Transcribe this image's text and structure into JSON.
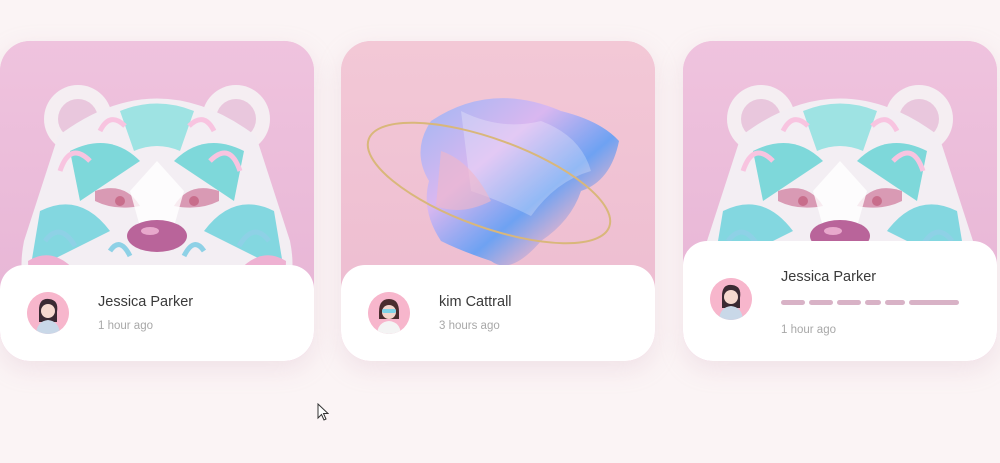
{
  "cards": [
    {
      "artwork": "paper-bear-artwork",
      "name": "Jessica Parker",
      "time": "1 hour ago"
    },
    {
      "artwork": "holographic-shape-artwork",
      "name": "kim Cattrall",
      "time": "3 hours ago"
    },
    {
      "artwork": "paper-bear-artwork",
      "name": "Jessica Parker",
      "time": "1 hour ago",
      "loading": true
    }
  ],
  "colors": {
    "background": "#fbf4f5",
    "card_pink": "#f3c6dc",
    "loading_bar": "#d8b2c6"
  }
}
